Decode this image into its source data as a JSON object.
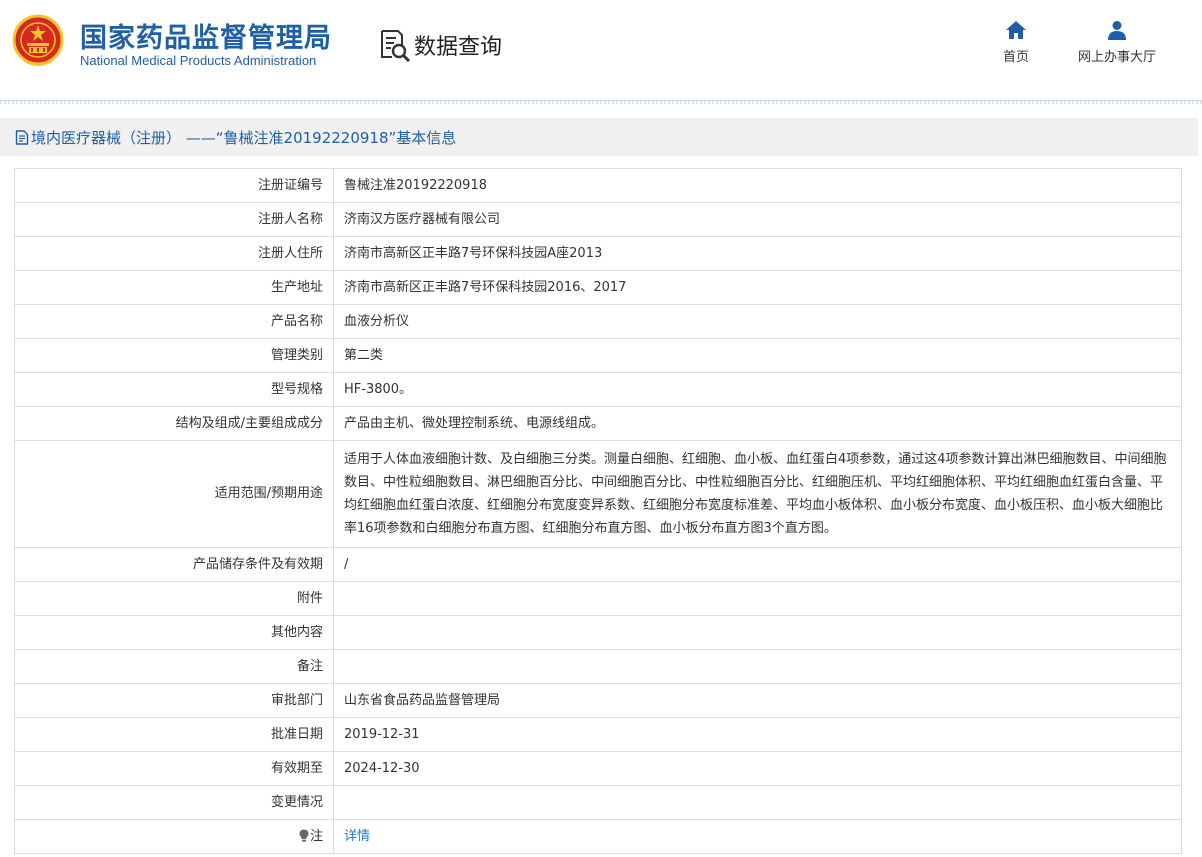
{
  "header": {
    "logo_cn": "国家药品监督管理局",
    "logo_en": "National Medical Products Administration",
    "query_title": "数据查询",
    "nav": [
      {
        "label": "首页",
        "icon": "home-icon"
      },
      {
        "label": "网上办事大厅",
        "icon": "user-icon"
      }
    ]
  },
  "title_bar": {
    "text": "境内医疗器械（注册） ——“鲁械注准20192220918”基本信息",
    "icon": "document-icon"
  },
  "rows": [
    {
      "label": "注册证编号",
      "value": "鲁械注准20192220918"
    },
    {
      "label": "注册人名称",
      "value": "济南汉方医疗器械有限公司"
    },
    {
      "label": "注册人住所",
      "value": "济南市高新区正丰路7号环保科技园A座2013"
    },
    {
      "label": "生产地址",
      "value": "济南市高新区正丰路7号环保科技园2016、2017"
    },
    {
      "label": "产品名称",
      "value": "血液分析仪"
    },
    {
      "label": "管理类别",
      "value": "第二类"
    },
    {
      "label": "型号规格",
      "value": "HF-3800。"
    },
    {
      "label": "结构及组成/主要组成成分",
      "value": "产品由主机、微处理控制系统、电源线组成。"
    },
    {
      "label": "适用范围/预期用途",
      "value": "适用于人体血液细胞计数、及白细胞三分类。测量白细胞、红细胞、血小板、血红蛋白4项参数，通过这4项参数计算出淋巴细胞数目、中间细胞数目、中性粒细胞数目、淋巴细胞百分比、中间细胞百分比、中性粒细胞百分比、红细胞压机、平均红细胞体积、平均红细胞血红蛋白含量、平均红细胞血红蛋白浓度、红细胞分布宽度变异系数、红细胞分布宽度标准差、平均血小板体积、血小板分布宽度、血小板压积、血小板大细胞比率16项参数和白细胞分布直方图、红细胞分布直方图、血小板分布直方图3个直方图。"
    },
    {
      "label": "产品储存条件及有效期",
      "value": "/"
    },
    {
      "label": "附件",
      "value": ""
    },
    {
      "label": "其他内容",
      "value": ""
    },
    {
      "label": "备注",
      "value": ""
    },
    {
      "label": "审批部门",
      "value": "山东省食品药品监督管理局"
    },
    {
      "label": "批准日期",
      "value": "2019-12-31"
    },
    {
      "label": "有效期至",
      "value": "2024-12-30"
    },
    {
      "label": "变更情况",
      "value": ""
    }
  ],
  "note_row": {
    "label": "注",
    "link": "详情",
    "icon": "lightbulb-icon"
  },
  "colors": {
    "brand_blue": "#1f5fa8",
    "link_blue": "#1f7ad0",
    "title_bg": "#f0f0f0",
    "emblem_red": "#d7281d",
    "emblem_gold": "#f4c430"
  }
}
